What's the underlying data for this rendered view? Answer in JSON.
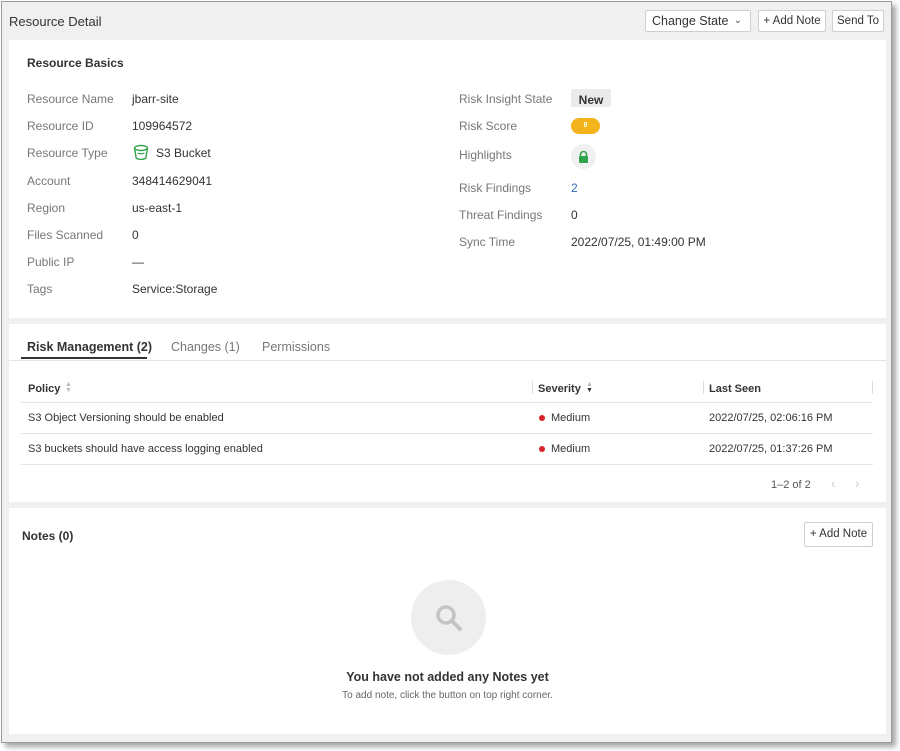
{
  "header": {
    "title": "Resource Detail",
    "change_state_label": "Change State",
    "add_note_label": "+ Add Note",
    "send_to_label": "Send To"
  },
  "basics": {
    "title": "Resource Basics",
    "left_fields": [
      {
        "label": "Resource Name",
        "value": "jbarr-site"
      },
      {
        "label": "Resource ID",
        "value": "109964572"
      },
      {
        "label": "Resource Type",
        "value": "S3 Bucket",
        "icon": "s3-bucket-icon"
      },
      {
        "label": "Account",
        "value": "348414629041"
      },
      {
        "label": "Region",
        "value": "us-east-1"
      },
      {
        "label": "Files Scanned",
        "value": "0"
      },
      {
        "label": "Public IP",
        "value": "—"
      },
      {
        "label": "Tags",
        "value": "Service:Storage"
      }
    ],
    "right_fields": [
      {
        "label": "Risk Insight State",
        "value": "New"
      },
      {
        "label": "Risk Score",
        "value": "9"
      },
      {
        "label": "Highlights",
        "icon": "lock-icon"
      },
      {
        "label": "Risk Findings",
        "value": "2"
      },
      {
        "label": "Threat Findings",
        "value": "0"
      },
      {
        "label": "Sync Time",
        "value": "2022/07/25, 01:49:00 PM"
      }
    ]
  },
  "tabs": [
    {
      "label": "Risk Management (2)",
      "active": true
    },
    {
      "label": "Changes (1)",
      "active": false
    },
    {
      "label": "Permissions",
      "active": false
    }
  ],
  "risk_table": {
    "columns": [
      "Policy",
      "Severity",
      "Last Seen"
    ],
    "rows": [
      {
        "policy": "S3 Object Versioning should be enabled",
        "severity": "Medium",
        "last_seen": "2022/07/25, 02:06:16 PM"
      },
      {
        "policy": "S3 buckets should have access logging enabled",
        "severity": "Medium",
        "last_seen": "2022/07/25, 01:37:26 PM"
      }
    ],
    "pagination": "1–2 of 2"
  },
  "notes": {
    "title": "Notes (0)",
    "add_note_label": "+ Add Note",
    "empty_title": "You have not added any Notes yet",
    "empty_subtitle": "To add note, click the button on top right corner."
  },
  "colors": {
    "score": "#f2b31b",
    "severity_medium": "#d8232a",
    "link": "#2d6fb5",
    "lock": "#2ea34a"
  }
}
